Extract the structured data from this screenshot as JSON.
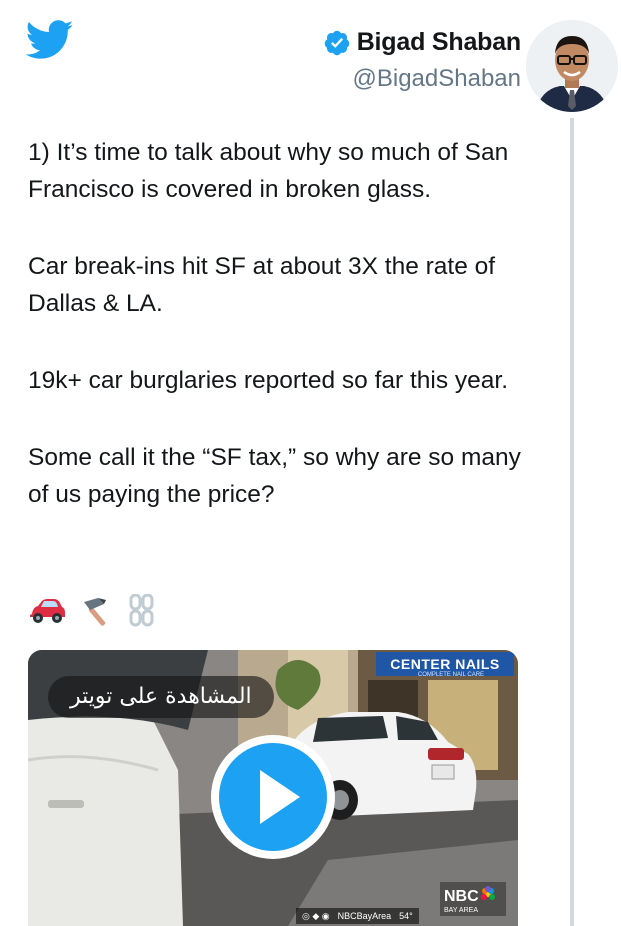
{
  "header": {
    "display_name": "Bigad Shaban",
    "handle": "@BigadShaban"
  },
  "tweet": {
    "paragraphs": [
      "1) It’s time to talk about why so much of San Francisco is covered in broken glass.",
      "Car break-ins hit SF at about 3X the rate of Dallas & LA.",
      "19k+ car burglaries reported so far this year.",
      "Some call it the “SF tax,” so why are so many of us paying the price?"
    ],
    "emojis": [
      "car-emoji",
      "hammer-emoji",
      "chains-emoji"
    ]
  },
  "media": {
    "overlay_label": "المشاهدة على تويتر",
    "store_sign": "CENTER NAILS",
    "store_sub": "COMPLETE NAIL CARE",
    "ticker_handle": "NBCBayArea",
    "ticker_temp": "54°",
    "channel_logo": "NBC",
    "channel_sub": "BAY AREA"
  },
  "colors": {
    "twitter_blue": "#1da1f2",
    "text": "#14171a",
    "secondary": "#657786",
    "thread_line": "#cfd9de"
  },
  "icons": {
    "logo": "twitter-bird-icon",
    "verified": "verified-badge-icon",
    "play": "play-icon"
  }
}
